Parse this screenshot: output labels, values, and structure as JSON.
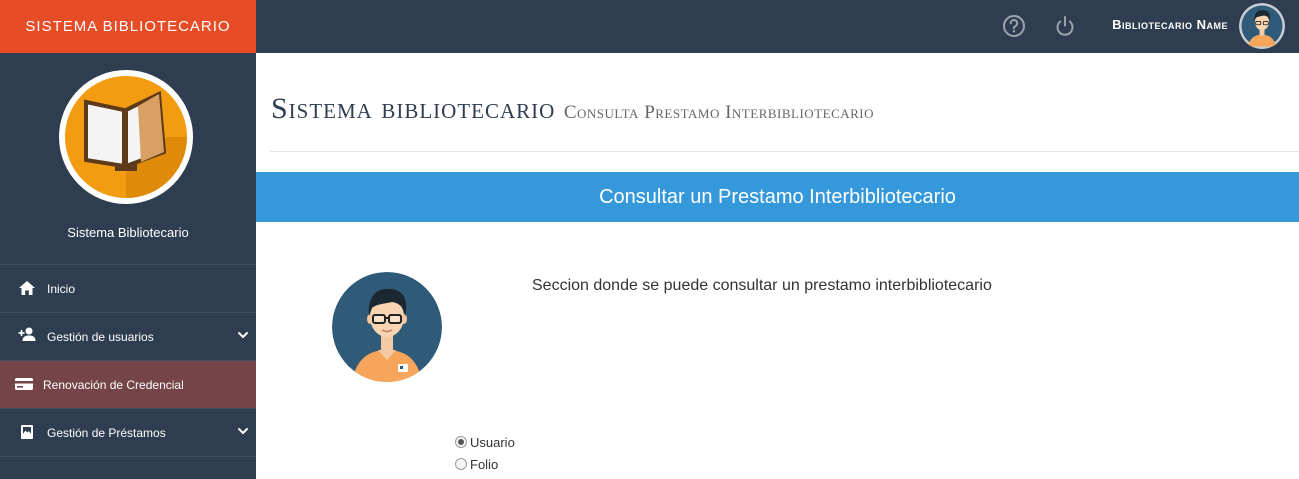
{
  "app": {
    "brand": "SISTEMA BIBLIOTECARIO"
  },
  "topbar": {
    "help_icon": "help-circle-icon",
    "power_icon": "power-icon",
    "user_name": "Bibliotecario Name"
  },
  "sidebar": {
    "title": "Sistema Bibliotecario",
    "items": [
      {
        "label": "Inicio",
        "icon": "home-icon",
        "has_submenu": false,
        "active": false
      },
      {
        "label": "Gestión de usuarios",
        "icon": "add-user-icon",
        "has_submenu": true,
        "active": false
      },
      {
        "label": "Renovación de Credencial",
        "icon": "credit-card-icon",
        "has_submenu": false,
        "active": true
      },
      {
        "label": "Gestión de Préstamos",
        "icon": "book-icon",
        "has_submenu": true,
        "active": false
      }
    ]
  },
  "main": {
    "title": "Sistema bibliotecario",
    "subtitle": "Consulta Prestamo Interbibliotecario",
    "panel_header": "Consultar un Prestamo Interbibliotecario",
    "description": "Seccion donde se puede consultar un prestamo interbibliotecario",
    "options": [
      {
        "label": "Usuario",
        "checked": true
      },
      {
        "label": "Folio",
        "checked": false
      }
    ]
  },
  "colors": {
    "brand": "#e64c26",
    "navbar": "#2e3e50",
    "active_item": "#754449",
    "panel_header": "#3498db"
  }
}
